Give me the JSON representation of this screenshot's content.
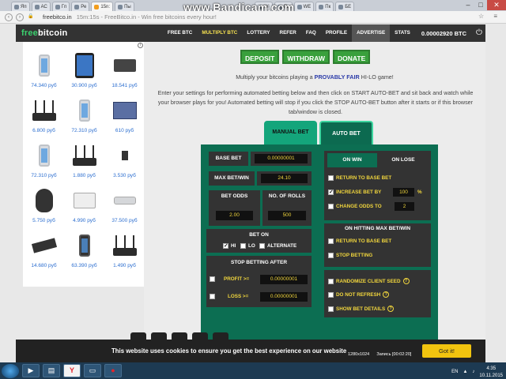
{
  "watermark": "www.Bandicam.com",
  "browser": {
    "tabs": [
      "Яп",
      "АС",
      "Гп",
      "Ре",
      "15n:",
      "Пы",
      "Wi",
      "Пк",
      "WE",
      "Пк",
      "БЕ"
    ],
    "url": "freebitco.in",
    "title_suffix": "15m:15s - FreeBitco.in - Win free bitcoins every hour!"
  },
  "site": {
    "logo_free": "free",
    "logo_bitcoin": "bitcoin",
    "nav": [
      "FREE BTC",
      "MULTIPLY BTC",
      "LOTTERY",
      "REFER",
      "FAQ",
      "PROFILE",
      "ADVERTISE",
      "STATS"
    ],
    "balance": "0.00002920 BTC"
  },
  "ads": [
    {
      "icon": "iphone",
      "price": "74.340 руб"
    },
    {
      "icon": "ipad",
      "price": "30.900 руб"
    },
    {
      "icon": "printer",
      "price": "18.541 руб"
    },
    {
      "icon": "router",
      "price": "6.800 руб"
    },
    {
      "icon": "iphone",
      "price": "72.310 руб"
    },
    {
      "icon": "box",
      "price": "610 руб"
    },
    {
      "icon": "iphone",
      "price": "72.310 руб"
    },
    {
      "icon": "router",
      "price": "1.880 руб"
    },
    {
      "icon": "usb-modem",
      "price": "3.530 руб"
    },
    {
      "icon": "mouse",
      "price": "5.750 руб"
    },
    {
      "icon": "printer",
      "price": "4.990 руб"
    },
    {
      "icon": "mac-mini",
      "price": "37.500 руб"
    },
    {
      "icon": "gpu",
      "price": "14.680 руб"
    },
    {
      "icon": "iphone-dark",
      "price": "63.390 руб"
    },
    {
      "icon": "router",
      "price": "1.490 руб"
    }
  ],
  "main": {
    "deposit": "DEPOSIT",
    "withdraw": "WITHDRAW",
    "donate": "DONATE",
    "multiply_text": "Multiply your bitcoins playing a",
    "provably_fair": "PROVABLY FAIR",
    "game": "HI-LO game!",
    "description": "Enter your settings for performing automated betting below and then click on START AUTO-BET and sit back and watch while your browser plays for you! Automated betting will stop if you click the STOP AUTO-BET button after it starts or if this browser tab/window is closed.",
    "tab_manual": "MANUAL BET",
    "tab_auto": "AUTO BET"
  },
  "autobet": {
    "base_bet_label": "BASE BET",
    "base_bet": "0.00000001",
    "max_bet_label": "MAX BET/WIN",
    "max_bet": "24.10",
    "bet_odds_label": "BET ODDS",
    "bet_odds": "2.00",
    "rolls_label": "NO. OF ROLLS",
    "rolls": "500",
    "bet_on_label": "BET ON",
    "hi": "HI",
    "lo": "LO",
    "alternate": "ALTERNATE",
    "stop_label": "STOP BETTING AFTER",
    "profit_label": "PROFIT >=",
    "profit": "0.00000001",
    "loss_label": "LOSS >=",
    "loss": "0.00000001",
    "on_win": "ON WIN",
    "on_lose": "ON LOSE",
    "return_base": "RETURN TO BASE BET",
    "increase_by": "INCREASE BET BY",
    "increase_val": "100",
    "percent": "%",
    "change_odds": "CHANGE ODDS TO",
    "change_odds_val": "2",
    "max_hit_label": "ON HITTING MAX BET/WIN",
    "max_return": "RETURN TO BASE BET",
    "stop_betting": "STOP BETTING",
    "randomize": "RANDOMIZE CLIENT SEED",
    "no_refresh": "DO NOT REFRESH",
    "show_details": "SHOW BET DETAILS"
  },
  "cookie": {
    "message": "This website uses cookies to ensure you get the best experience on our website",
    "button": "Got it!"
  },
  "taskbar": {
    "lang": "EN",
    "time": "4:35",
    "date": "10.11.2015",
    "rec_res": "1280x1024",
    "rec_time": "Запись [00:02:20]"
  }
}
